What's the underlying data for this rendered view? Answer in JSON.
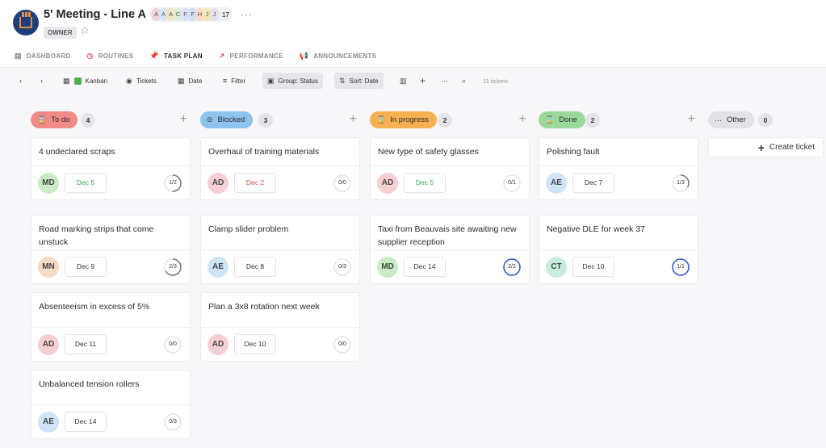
{
  "header": {
    "title": "5' Meeting - Line A",
    "role_badge": "OWNER",
    "members": [
      "A",
      "A",
      "A",
      "C",
      "F",
      "F",
      "H",
      "J",
      "J"
    ],
    "members_count": "17",
    "more": "···"
  },
  "tabs": [
    {
      "label": "DASHBOARD",
      "icon": "table-icon"
    },
    {
      "label": "ROUTINES",
      "icon": "clock-icon"
    },
    {
      "label": "TASK PLAN",
      "icon": "pin-icon",
      "active": true
    },
    {
      "label": "PERFORMANCE",
      "icon": "chart-icon"
    },
    {
      "label": "ANNOUNCEMENTS",
      "icon": "megaphone-icon"
    }
  ],
  "toolbar": {
    "kanban": "Kanban",
    "tickets": "Tickets",
    "date": "Date",
    "filter": "Filter",
    "group": "Group: Status",
    "sort": "Sort: Date",
    "ticket_count": "11 tickets"
  },
  "columns": [
    {
      "label": "To do",
      "count": "4",
      "color": "#f08b88",
      "cards": [
        {
          "title": "4 undeclared scraps",
          "initials": "MD",
          "date": "Dec 5",
          "date_style": "green",
          "progress": "1/2",
          "fraction": 0.5
        },
        {
          "title": "Road marking strips that come unstuck",
          "initials": "MN",
          "date": "Dec 9",
          "date_style": "",
          "progress": "2/3",
          "fraction": 0.667
        },
        {
          "title": "Absenteeism in excess of 5%",
          "initials": "AD",
          "date": "Dec 11",
          "date_style": "",
          "progress": "0/0",
          "fraction": 0
        },
        {
          "title": "Unbalanced tension rollers",
          "initials": "AE",
          "date": "Dec 14",
          "date_style": "",
          "progress": "0/3",
          "fraction": 0
        }
      ]
    },
    {
      "label": "Blocked",
      "count": "3",
      "color": "#8ec3ee",
      "cards": [
        {
          "title": "Overhaul of training materials",
          "initials": "AD",
          "date": "Dec 2",
          "date_style": "red",
          "progress": "0/0",
          "fraction": 0
        },
        {
          "title": "Clamp slider problem",
          "initials": "AE",
          "date": "Dec 8",
          "date_style": "",
          "progress": "0/3",
          "fraction": 0
        },
        {
          "title": "Plan a 3x8 rotation next week",
          "initials": "AD",
          "date": "Dec 10",
          "date_style": "",
          "progress": "0/0",
          "fraction": 0
        }
      ]
    },
    {
      "label": "In progress",
      "count": "2",
      "color": "#f6b04f",
      "cards": [
        {
          "title": "New type of safety glasses",
          "initials": "AD",
          "date": "Dec 5",
          "date_style": "green",
          "progress": "0/1",
          "fraction": 0
        },
        {
          "title": "Taxi from Beauvais site awaiting new supplier reception",
          "initials": "MD",
          "date": "Dec 14",
          "date_style": "",
          "progress": "2/2",
          "fraction": 1
        }
      ]
    },
    {
      "label": "Done",
      "count": "2",
      "color": "#9bd89b",
      "cards": [
        {
          "title": "Polishing fault",
          "initials": "AE",
          "date": "Dec 7",
          "date_style": "",
          "progress": "1/3",
          "fraction": 0.333
        },
        {
          "title": "Negative DLE for week 37",
          "initials": "CT",
          "date": "Dec 10",
          "date_style": "",
          "progress": "1/1",
          "fraction": 1
        }
      ]
    },
    {
      "label": "Other",
      "count": "0",
      "color": "#e2e2e6",
      "cards": []
    }
  ],
  "create_ticket": "Create ticket",
  "avatar_colors": {
    "MD": "#c9ecc4",
    "MN": "#f8d9c2",
    "AD": "#f6cfd3",
    "AE": "#cfe4f7",
    "CT": "#c7eedc"
  }
}
